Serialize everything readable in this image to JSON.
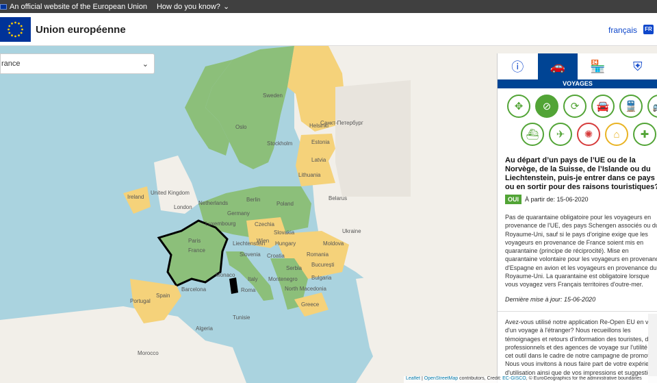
{
  "topbar": {
    "official_text": "An official website of the European Union",
    "how_text": "How do you know?"
  },
  "header": {
    "title": "Union européenne",
    "language": "français",
    "lang_code": "FR"
  },
  "select": {
    "value": "rance"
  },
  "map": {
    "cities": [
      "Sweden",
      "Oslo",
      "Stockholm",
      "Helsinki",
      "Санкт-Петербург",
      "Estonia",
      "Latvia",
      "Lithuania",
      "United Kingdom",
      "Ireland",
      "London",
      "Netherlands",
      "Berlin",
      "Germany",
      "Poland",
      "Belarus",
      "Czechia",
      "Slovakia",
      "Luxembourg",
      "Paris",
      "France",
      "Liechtenstein",
      "Wien",
      "Hungary",
      "Moldova",
      "Ukraine",
      "Romania",
      "București",
      "Bulgaria",
      "Serbia",
      "Montenegro",
      "North Macedonia",
      "Italy",
      "Roma",
      "Spain",
      "Portugal",
      "Barcelona",
      "Greece",
      "Algeria",
      "Morocco",
      "Tunisie",
      "Croatia",
      "Monaco",
      "Slovenia"
    ]
  },
  "panel": {
    "tabs": [
      "info-icon",
      "car-icon",
      "shop-icon",
      "shield-icon"
    ],
    "section": "VOYAGES",
    "question": "Au départ d’un pays de l’UE ou de la Norvège, de la Suisse, de l’Islande ou du Liechtenstein, puis-je entrer dans ce pays ou en sortir pour des raisons touristiques?",
    "badge": "OUI",
    "since": "À partir de: 15-06-2020",
    "body": "Pas de quarantaine obligatoire pour les voyageurs en provenance de l'UE, des pays Schengen associés ou du Royaume-Uni, sauf si le pays d'origine exige que les voyageurs en provenance de France soient mis en quarantaine (principe de réciprocité). Mise en quarantaine volontaire pour les voyageurs en provenance d'Espagne en avion et les voyageurs en provenance du Royaume-Uni. La quarantaine est obligatoire lorsque vous voyagez vers Français territoires d'outre-mer.",
    "updated": "Dernière mise à jour: 15-06-2020",
    "feedback": "Avez-vous utilisé notre application Re-Open EU en vue d'un voyage à l'étranger? Nous recueillons les témoignages et retours d'information des touristes, des professionnels et des agences de voyage sur l'utilité de cet outil dans le cadre de notre campagne de promotion. Nous vous invitons à nous faire part de votre expérience d'utilisation ainsi que de vos impressions et suggestions."
  },
  "attribution": {
    "leaflet": "Leaflet",
    "osm": "OpenStreetMap",
    "mid": " contributors, Credit: ",
    "ec": "EC-GISCO",
    "tail": ", © EuroGeographics for the administrative boundaries"
  },
  "colors": {
    "green": "#8cbf7a",
    "yellow": "#f5d27a",
    "sea": "#aad3df",
    "land": "#f2efe9",
    "eu_blue": "#004494"
  }
}
